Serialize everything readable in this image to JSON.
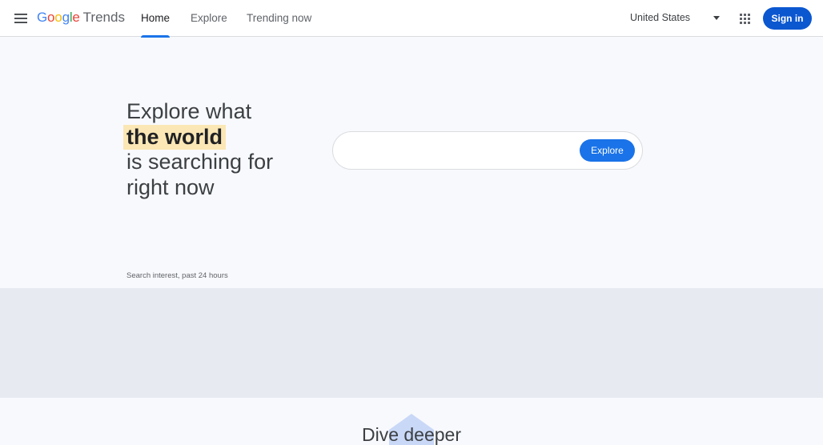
{
  "header": {
    "logo_google": [
      "G",
      "o",
      "o",
      "g",
      "l",
      "e"
    ],
    "logo_colors": [
      "#4285f4",
      "#ea4335",
      "#fbbc05",
      "#4285f4",
      "#34a853",
      "#ea4335"
    ],
    "logo_product": "Trends",
    "nav": [
      {
        "label": "Home",
        "active": true
      },
      {
        "label": "Explore",
        "active": false
      },
      {
        "label": "Trending now",
        "active": false
      }
    ],
    "country": "United States",
    "signin_label": "Sign in",
    "icons": [
      "menu-icon",
      "dropdown-caret-icon",
      "apps-grid-icon"
    ]
  },
  "hero": {
    "line1": "Explore what",
    "line2": "the world",
    "line3": "is searching for",
    "line4": "right now",
    "highlight_color": "#fbe7b5"
  },
  "search": {
    "value": "",
    "placeholder": "",
    "button_label": "Explore",
    "button_color": "#1a73e8"
  },
  "interest": {
    "label": "Search interest, past 24 hours"
  },
  "dive": {
    "title": "Dive deeper"
  },
  "colors": {
    "accent": "#1a73e8",
    "signin": "#0b57d0",
    "band": "#e8eaf2",
    "background": "#f8f9fd"
  }
}
